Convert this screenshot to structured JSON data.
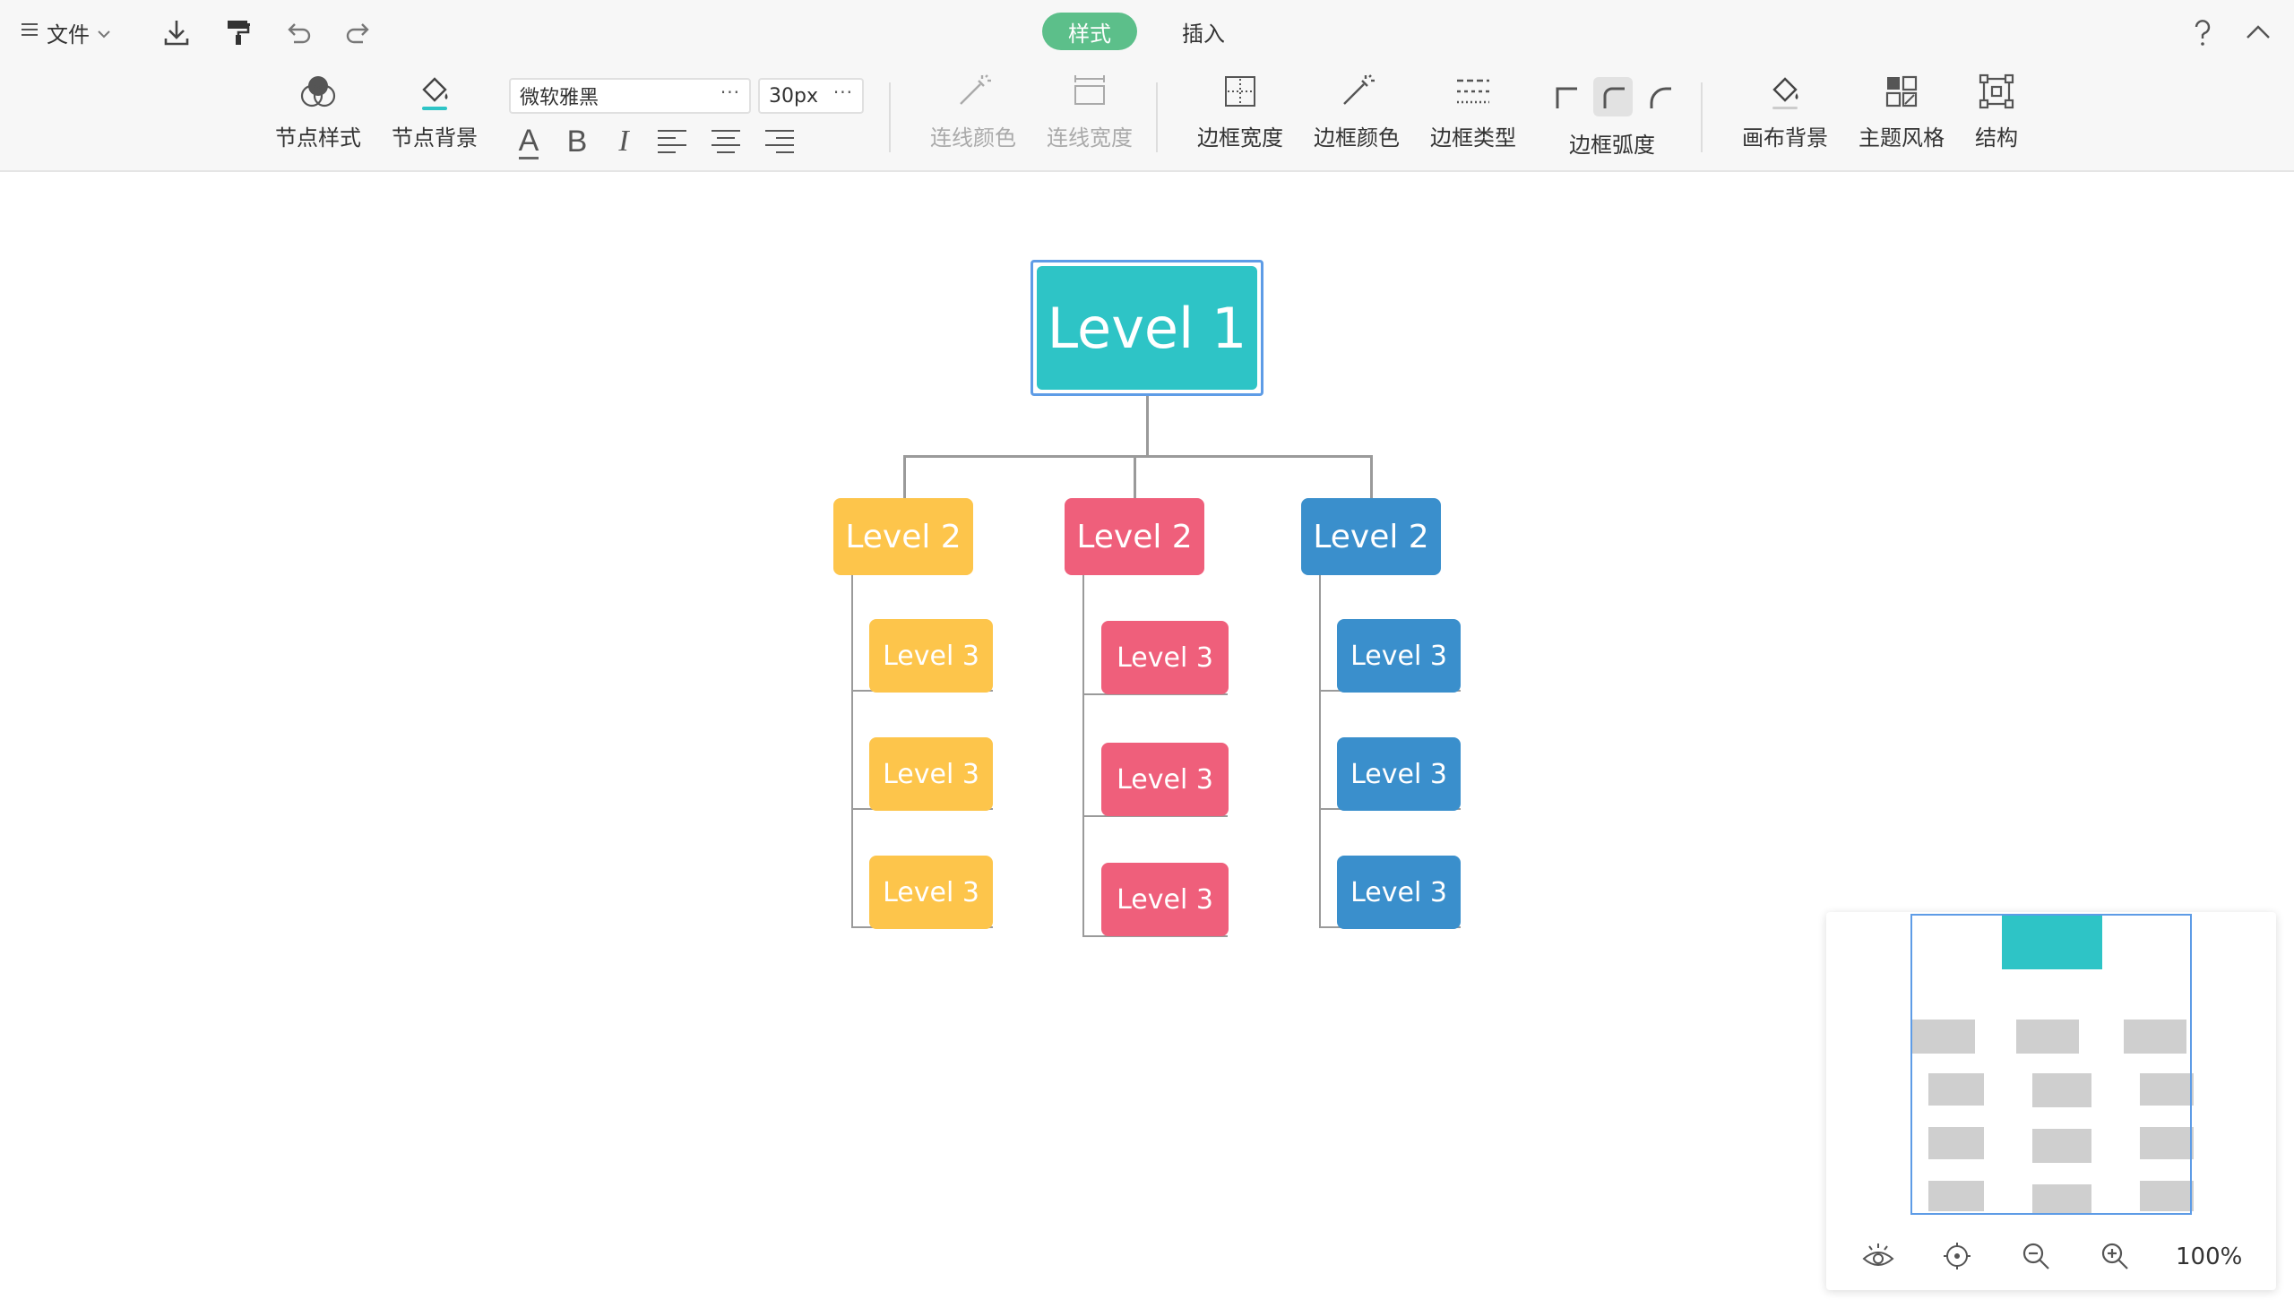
{
  "toolbar": {
    "file_label": "文件",
    "tabs": {
      "style": "样式",
      "insert": "插入"
    },
    "help_icon": "question-mark",
    "tools": {
      "node_style": "节点样式",
      "node_background": "节点背景",
      "line_color": "连线颜色",
      "line_width": "连线宽度",
      "border_width": "边框宽度",
      "border_color": "边框颜色",
      "border_type": "边框类型",
      "border_radius": "边框弧度",
      "canvas_background": "画布背景",
      "theme_style": "主题风格",
      "structure": "结构"
    },
    "font_family": "微软雅黑",
    "font_size": "30px",
    "format_glyphs": {
      "font_color": "A",
      "bold": "B",
      "italic": "I"
    }
  },
  "mindmap": {
    "root": "Level 1",
    "branches": [
      {
        "label": "Level 2",
        "color": "#fdc54b",
        "children": [
          "Level 3",
          "Level 3",
          "Level 3"
        ]
      },
      {
        "label": "Level 2",
        "color": "#ef5f7b",
        "children": [
          "Level 3",
          "Level 3",
          "Level 3"
        ]
      },
      {
        "label": "Level 2",
        "color": "#3a8fcc",
        "children": [
          "Level 3",
          "Level 3",
          "Level 3"
        ]
      }
    ],
    "root_color": "#2ec4c6"
  },
  "navigator": {
    "zoom": "100%"
  },
  "colors": {
    "accent": "#5cbf8a",
    "selection": "#5e9ce6"
  }
}
